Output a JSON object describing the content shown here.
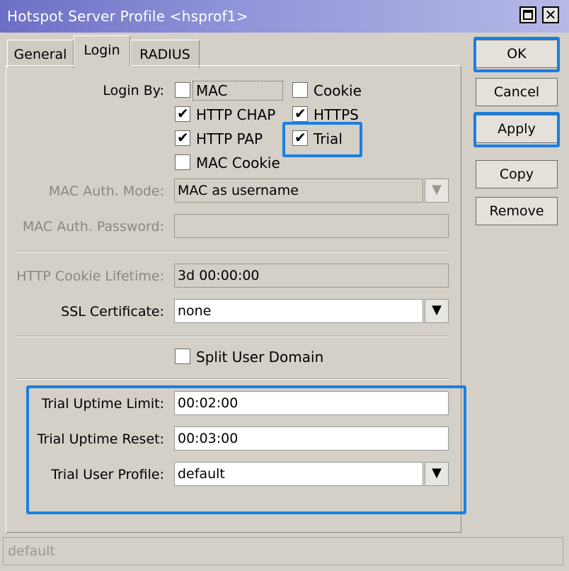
{
  "window": {
    "title": "Hotspot Server Profile <hsprof1>",
    "maximize_glyph": "",
    "close_glyph": "✕"
  },
  "tabs": [
    {
      "label": "General",
      "active": false
    },
    {
      "label": "Login",
      "active": true
    },
    {
      "label": "RADIUS",
      "active": false
    }
  ],
  "login_by": {
    "label": "Login By:",
    "options": [
      {
        "label": "MAC",
        "checked": false
      },
      {
        "label": "Cookie",
        "checked": false
      },
      {
        "label": "HTTP CHAP",
        "checked": true
      },
      {
        "label": "HTTPS",
        "checked": true
      },
      {
        "label": "HTTP PAP",
        "checked": true
      },
      {
        "label": "Trial",
        "checked": true
      },
      {
        "label": "MAC Cookie",
        "checked": false
      }
    ],
    "check_glyph": "✔"
  },
  "mac_auth_mode": {
    "label": "MAC Auth. Mode:",
    "value": "MAC as username",
    "button_glyph": "▼"
  },
  "mac_auth_password": {
    "label": "MAC Auth. Password:",
    "value": ""
  },
  "http_cookie_lifetime": {
    "label": "HTTP Cookie Lifetime:",
    "value": "3d 00:00:00"
  },
  "ssl_certificate": {
    "label": "SSL Certificate:",
    "value": "none",
    "button_glyph": "▼"
  },
  "split_user_domain": {
    "label": "Split User Domain",
    "checked": false
  },
  "trial": {
    "uptime_limit": {
      "label": "Trial Uptime Limit:",
      "value": "00:02:00"
    },
    "uptime_reset": {
      "label": "Trial Uptime Reset:",
      "value": "00:03:00"
    },
    "user_profile": {
      "label": "Trial User Profile:",
      "value": "default",
      "button_glyph": "▼"
    }
  },
  "buttons": {
    "ok": "OK",
    "cancel": "Cancel",
    "apply": "Apply",
    "copy": "Copy",
    "remove": "Remove"
  },
  "status": {
    "text": "default"
  },
  "colors": {
    "highlight": "#1a7fe0",
    "title_bar": "#6c6fc4",
    "background": "#d4d0c8"
  }
}
